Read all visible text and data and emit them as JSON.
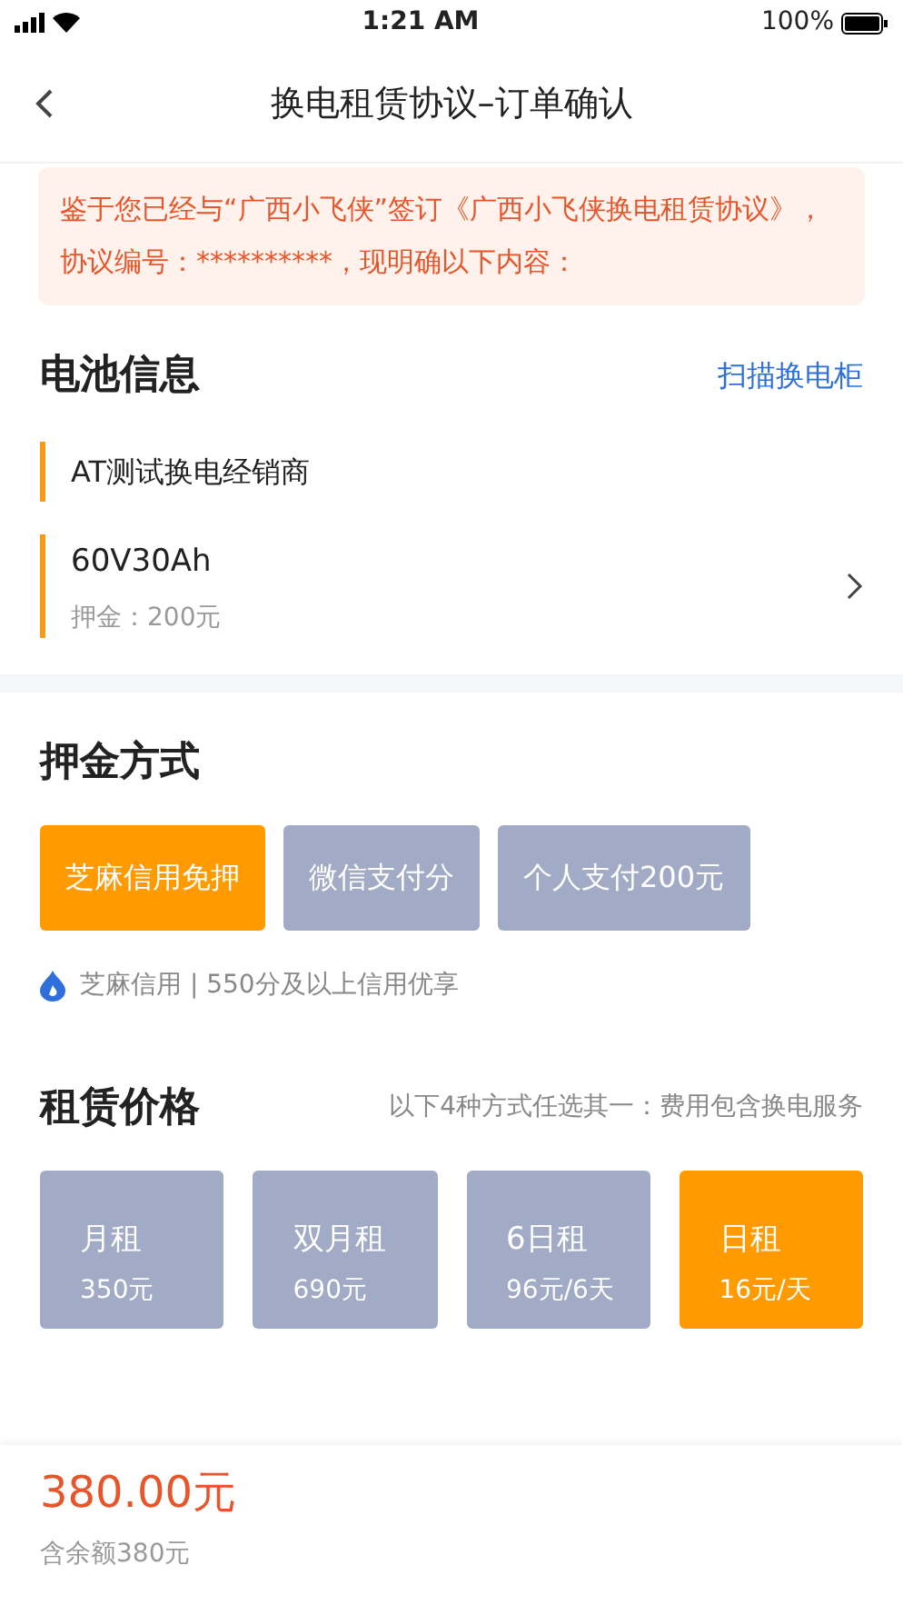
{
  "status_bar": {
    "time": "1:21 AM",
    "battery": "100%"
  },
  "nav": {
    "title": "换电租赁协议–订单确认"
  },
  "notice": "鉴于您已经与“广西小飞侠”签订《广西小飞侠换电租赁协议》，协议编号：**********，现明确以下内容：",
  "battery_section": {
    "title": "电池信息",
    "action": "扫描换电柜",
    "items": [
      {
        "kind": "dealer",
        "name": "AT测试换电经销商"
      },
      {
        "kind": "battery",
        "name": "60V30Ah",
        "detail": "押金：200元"
      }
    ]
  },
  "deposit_section": {
    "title": "押金方式",
    "options": [
      {
        "label": "芝麻信用免押",
        "selected": true
      },
      {
        "label": "微信支付分",
        "selected": false
      },
      {
        "label": "个人支付200元",
        "selected": false
      }
    ],
    "note": "芝麻信用 | 550分及以上信用优享"
  },
  "rent_section": {
    "title": "租赁价格",
    "hint": "以下4种方式任选其一：费用包含换电服务",
    "plans": [
      {
        "name": "月租",
        "price": "350元",
        "selected": false
      },
      {
        "name": "双月租",
        "price": "690元",
        "selected": false
      },
      {
        "name": "6日租",
        "price": "96元/6天",
        "selected": false
      },
      {
        "name": "日租",
        "price": "16元/天",
        "selected": true
      }
    ]
  },
  "footer": {
    "total": "380.00元",
    "detail": "含余额380元"
  }
}
